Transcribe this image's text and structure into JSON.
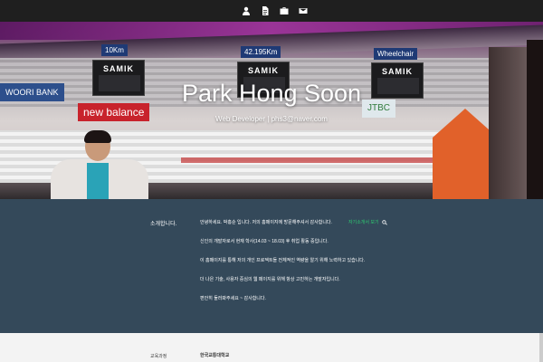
{
  "nav": {
    "items": [
      {
        "icon": "user-icon",
        "label": "About"
      },
      {
        "icon": "document-icon",
        "label": "Resume"
      },
      {
        "icon": "briefcase-icon",
        "label": "Portfolio"
      },
      {
        "icon": "envelope-icon",
        "label": "Contact"
      }
    ]
  },
  "hero": {
    "name": "Park Hong Soon",
    "subtitle": "Web Developer | phs3@naver.com",
    "scene_text": {
      "sign_10km": "10Km",
      "sign_42km": "42.195Km",
      "sign_wheelchair": "Wheelchair",
      "scoreboard_brand": "SAMIK",
      "bank_banner": "WOORI BANK",
      "new_balance_banner": "new balance",
      "jtbc": "JTBC"
    }
  },
  "about": {
    "label": "소개합니다.",
    "paragraphs": [
      "안녕하세요. 박홍순 입니다. 저의 홈페이지에 방문해주셔서 감사합니다.",
      "신인의 개발자로서 현재 학사(14.03 ~ 18.03) 후 취업 활동 중입니다.",
      "이 홈페이지를 통해 저의 개인 프로젝트들 전체적인 역량을 알기 위해 노력하고 있습니다.",
      "더 나은 기술, 사용자 중심의 웹 페이지를 위해 항상 고민하는 개발자입니다.",
      "편안히 둘러봐주세요 ~ 감사합니다."
    ],
    "link_label": "자기소개서 보기"
  },
  "education": {
    "label": "교육과정",
    "school": "한국교통대학교"
  },
  "colors": {
    "topbar": "#1f1f1f",
    "about_bg": "#34495a",
    "accent_green": "#2ecc71",
    "edu_bg": "#f3f3f3"
  }
}
